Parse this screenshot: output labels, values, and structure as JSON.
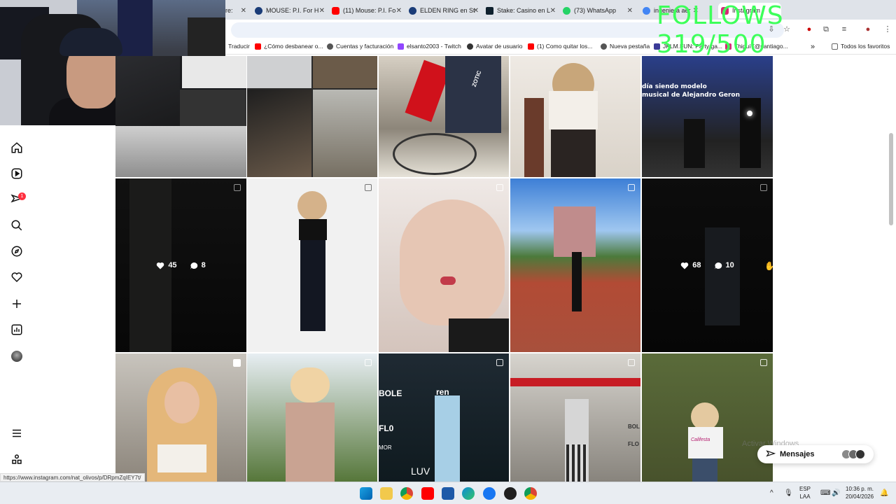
{
  "overlay_text": "FOLLOWS 319/500",
  "tabs": [
    {
      "title": "re:",
      "color": "#888888"
    },
    {
      "title": "MOUSE: P.I. For H",
      "color": "#1a3c78"
    },
    {
      "title": "(11) Mouse: P.I. Fo",
      "color": "#ff0000"
    },
    {
      "title": "ELDEN RING en St",
      "color": "#1a3c78"
    },
    {
      "title": "Stake: Casino en L",
      "color": "#0f212e"
    },
    {
      "title": "(73) WhatsApp",
      "color": "#25d366"
    },
    {
      "title": "ingeniera aer",
      "color": "#4285f4"
    },
    {
      "title": "Instagram",
      "color": "#d62976"
    }
  ],
  "bookmarks": [
    {
      "label": "Traducir",
      "color": "#4285f4"
    },
    {
      "label": "¿Cómo desbanear o...",
      "color": "#ff0000"
    },
    {
      "label": "Cuentas y facturación",
      "color": "#555555"
    },
    {
      "label": "elsanto2003 - Twitch",
      "color": "#9146ff"
    },
    {
      "label": "Avatar de usuario",
      "color": "#333333"
    },
    {
      "label": "(1) Como quitar los...",
      "color": "#ff0000"
    },
    {
      "label": "Nueva pestaña",
      "color": "#555555"
    },
    {
      "label": "JKLM.FUN: Party ga...",
      "color": "#3b3b98"
    },
    {
      "label": "Thiguí (@santiago...",
      "color": "#d62976"
    },
    {
      "label": "Todos los favoritos",
      "color": "#666666"
    }
  ],
  "sidebar": {
    "notification_count": "1",
    "icons": [
      "home-icon",
      "reels-icon",
      "messages-icon",
      "search-icon",
      "explore-icon",
      "notifications-icon",
      "create-icon",
      "dashboard-icon",
      "profile-icon",
      "menu-icon",
      "more-icon"
    ]
  },
  "posts": [
    {
      "likes": "45",
      "comments": "8"
    },
    {
      "likes": "68",
      "comments": "10"
    }
  ],
  "tile_texts": {
    "top_right_caption_1": "día siendo modelo",
    "top_right_caption_2": "musical de Alejandro Geron",
    "shirt_text": "ZOTIC",
    "sign_1": "ren",
    "sign_2": "FL0",
    "sign_3": "LUV",
    "sign_4": "BOLE",
    "sign_5": "MOR",
    "sign_6": "FLO",
    "sign_7": "BOL",
    "sign_8": "Califesta"
  },
  "messages_label": "Mensajes",
  "windows_watermark": "Activar Windows",
  "windows_watermark_2": "Ve a Configuración para activar Windows.",
  "status_url": "https://www.instagram.com/nat_olivos/p/DRpmZqIEY7t/",
  "taskbar": {
    "lang": "ESP",
    "region": "LAA",
    "time": "10:36 p. m.",
    "date": "20/04/2026"
  }
}
